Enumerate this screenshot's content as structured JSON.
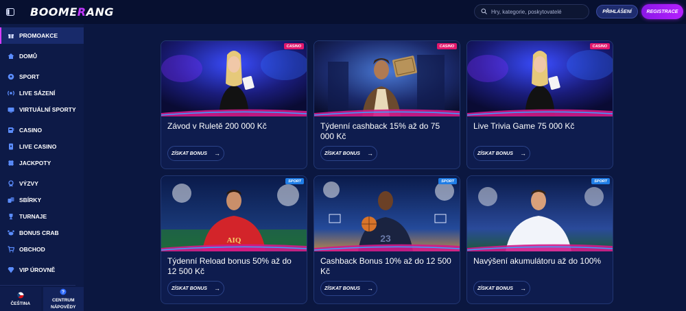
{
  "header": {
    "logo_pre": "BOOME",
    "logo_accent": "R",
    "logo_post": "ANG",
    "search_placeholder": "Hry, kategorie, poskytovatelé",
    "login_label": "PŘIHLÁŠENÍ",
    "register_label": "REGISTRACE"
  },
  "sidebar": {
    "items": [
      {
        "label": "PROMOAKCE",
        "icon": "gift-icon"
      },
      {
        "label": "DOMŮ",
        "icon": "home-icon"
      },
      {
        "label": "SPORT",
        "icon": "soccer-ball-icon"
      },
      {
        "label": "LIVE SÁZENÍ",
        "icon": "live-icon"
      },
      {
        "label": "VIRTUÁLNÍ SPORTY",
        "icon": "tv-icon"
      },
      {
        "label": "CASINO",
        "icon": "slot-icon"
      },
      {
        "label": "LIVE CASINO",
        "icon": "cards-icon"
      },
      {
        "label": "JACKPOTY",
        "icon": "clover-icon"
      },
      {
        "label": "VÝZVY",
        "icon": "medal-icon"
      },
      {
        "label": "SBÍRKY",
        "icon": "collection-icon"
      },
      {
        "label": "TURNAJE",
        "icon": "trophy-icon"
      },
      {
        "label": "BONUS CRAB",
        "icon": "crab-icon"
      },
      {
        "label": "OBCHOD",
        "icon": "cart-icon"
      },
      {
        "label": "VIP ÚROVNĚ",
        "icon": "diamond-icon"
      }
    ],
    "language_label": "ČEŠTINA",
    "help_label_1": "CENTRUM",
    "help_label_2": "NÁPOVĚDY"
  },
  "cards": [
    {
      "title": "Závod v Ruletě 200 000 Kč",
      "tag": "CASINO",
      "button": "ZÍSKAT BONUS"
    },
    {
      "title": "Týdenní cashback 15% až do 75 000 Kč",
      "tag": "CASINO",
      "button": "ZÍSKAT BONUS"
    },
    {
      "title": "Live Trivia Game 75 000 Kč",
      "tag": "CASINO",
      "button": "ZÍSKAT BONUS"
    },
    {
      "title": "Týdenní Reload bonus 50% až do 12 500 Kč",
      "tag": "SPORT",
      "button": "ZÍSKAT BONUS"
    },
    {
      "title": "Cashback Bonus 10% až do 12 500 Kč",
      "tag": "SPORT",
      "button": "ZÍSKAT BONUS"
    },
    {
      "title": "Navýšení akumulátoru až do 100%",
      "tag": "SPORT",
      "button": "ZÍSKAT BONUS"
    }
  ],
  "colors": {
    "accent": "#c237ff",
    "casino_tag": "#e2186c",
    "sport_tag": "#1f7de6",
    "background": "#0b1740"
  }
}
